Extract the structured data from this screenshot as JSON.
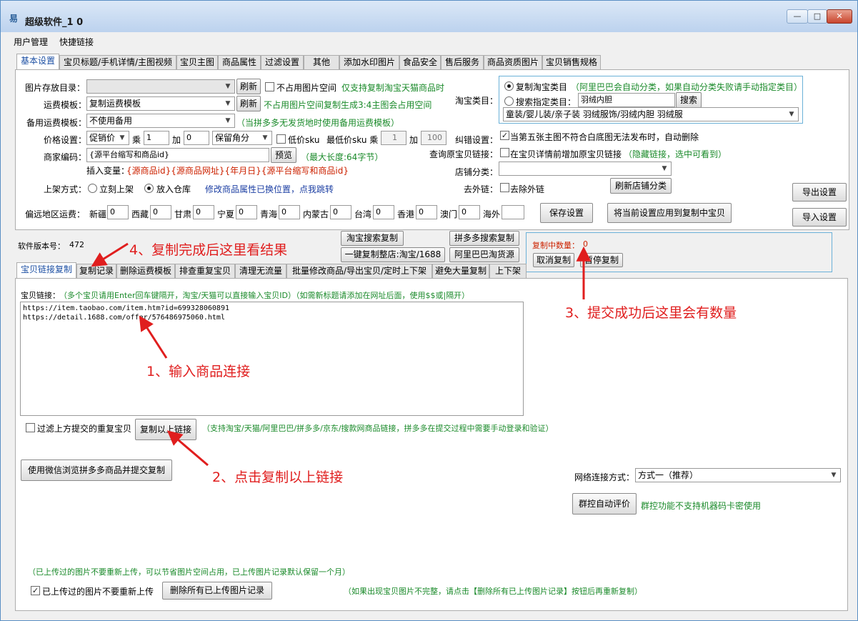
{
  "window": {
    "title": "超级软件_1 0",
    "btn_min": "—",
    "btn_max": "□",
    "btn_close": "✕"
  },
  "menu": [
    "用户管理",
    "快捷链接"
  ],
  "tabs_top": [
    "基本设置",
    "宝贝标题/手机详情/主图视频",
    "宝贝主图",
    "商品属性",
    "过滤设置",
    "其他",
    "添加水印图片",
    "食品安全",
    "售后服务",
    "商品资质图片",
    "宝贝销售规格"
  ],
  "basic": {
    "img_dir_label": "图片存放目录：",
    "img_dir_value": "",
    "refresh": "刷新",
    "no_img_space": "不占用图片空间",
    "only_taobao": "仅支持复制淘宝天猫商品时",
    "no_img_space_note": "不占用图片空间复制生成3:4主图会占用空间",
    "freight_label": "运费模板：",
    "freight_value": "复制运费模板",
    "backup_freight_label": "备用运费模板：",
    "backup_freight_value": "不使用备用",
    "backup_note": "（当拼多多无发货地时使用备用运费模板）",
    "price_label": "价格设置：",
    "price_mode": "促销价",
    "mul": "乘",
    "mul_value": "1",
    "add": "加",
    "add_value": "0",
    "round_mode": "保留角分",
    "low_sku": "低价sku",
    "min_sku": "最低价sku 乘",
    "min_sku_mul": "1",
    "min_sku_add_label": "加",
    "min_sku_add": "100",
    "merchant_code_label": "商家编码：",
    "merchant_code_value": "{源平台缩写和商品id}",
    "preview": "预览",
    "max_len": "（最大长度:64字节）",
    "insert_var": "插入变量：",
    "vars": "{源商品id}{源商品网址}{年月日}{源平台缩写和商品id}",
    "listing_label": "上架方式：",
    "listing_now": "立刻上架",
    "listing_store": "放入仓库",
    "attr_moved": "修改商品属性已换位置，点我跳转",
    "remote_label": "偏远地区运费：",
    "regions": [
      {
        "name": "新疆",
        "value": "0"
      },
      {
        "name": "西藏",
        "value": "0"
      },
      {
        "name": "甘肃",
        "value": "0"
      },
      {
        "name": "宁夏",
        "value": "0"
      },
      {
        "name": "青海",
        "value": "0"
      },
      {
        "name": "内蒙古",
        "value": "0"
      },
      {
        "name": "台湾",
        "value": "0"
      },
      {
        "name": "香港",
        "value": "0"
      },
      {
        "name": "澳门",
        "value": "0"
      },
      {
        "name": "海外",
        "value": ""
      }
    ],
    "save": "保存设置",
    "apply_copy": "将当前设置应用到复制中宝贝",
    "export": "导出设置",
    "import": "导入设置"
  },
  "category": {
    "label": "淘宝类目：",
    "copy_cat": "复制淘宝类目",
    "copy_note": "（阿里巴巴会自动分类，如果自动分类失败请手动指定类目）",
    "search_cat": "搜索指定类目：",
    "search_value": "羽绒内胆",
    "search_btn": "搜索",
    "cat_path": "童装/婴儿装/亲子装 羽绒服饰/羽绒内胆 羽绒服"
  },
  "right": {
    "error_label": "纠错设置：",
    "error_opt": "当第五张主图不符合白底图无法发布时，自动删除",
    "query_label": "查询原宝贝链接：",
    "query_opt": "在宝贝详情前增加原宝贝链接",
    "query_note": "（隐藏链接，选中可看到）",
    "shop_cat_label": "店铺分类：",
    "shop_cat_value": "",
    "outlink_label": "去外链：",
    "outlink_opt": "去除外链",
    "refresh_shop": "刷新店铺分类"
  },
  "version": {
    "label": "软件版本号：",
    "value": "472"
  },
  "search_buttons": [
    "淘宝搜索复制",
    "拼多多搜索复制",
    "一键复制整店:淘宝/1688",
    "阿里巴巴淘货源"
  ],
  "copying": {
    "label": "复制中数量：",
    "value": "0",
    "cancel": "取消复制",
    "pause": "暂停复制"
  },
  "tabs_bottom": [
    "宝贝链接复制",
    "复制记录",
    "删除运费模板",
    "排查重复宝贝",
    "清理无流量",
    "批量修改商品/导出宝贝/定时上下架",
    "避免大量复制",
    "上下架"
  ],
  "links": {
    "label": "宝贝链接：",
    "hint": "（多个宝贝请用Enter回车键隔开，淘宝/天猫可以直接输入宝贝ID）（如需新标题请添加在网址后面，使用$$或|隔开）",
    "lines": [
      "https://item.taobao.com/item.htm?id=699328060891",
      "https://detail.1688.com/offer/576486975060.html"
    ],
    "filter_dup": "过滤上方提交的重复宝贝",
    "copy_btn": "复制以上链接",
    "support_note": "（支持淘宝/天猫/阿里巴巴/拼多多/京东/搜款网商品链接，拼多多在提交过程中需要手动登录和验证）",
    "wechat_btn": "使用微信浏览拼多多商品并提交复制",
    "net_label": "网络连接方式：",
    "net_value": "方式一（推荐）",
    "group_btn": "群控自动评价",
    "group_note": "群控功能不支持机器码卡密使用",
    "uploaded_note": "（已上传过的图片不要重新上传，可以节省图片空间占用，已上传图片记录默认保留一个月）",
    "uploaded_opt": "已上传过的图片不要重新上传",
    "delete_records": "删除所有已上传图片记录",
    "incomplete_note": "（如果出现宝贝图片不完整，请点击【删除所有已上传图片记录】按钮后再重新复制）"
  },
  "annotations": {
    "a1": "1、输入商品连接",
    "a2": "2、点击复制以上链接",
    "a3": "3、提交成功后这里会有数量",
    "a4": "4、复制完成后这里看结果"
  },
  "colors": {
    "annotation": "#e01e1e",
    "green_text": "#1a8a2a",
    "blue_text": "#1c3fa3",
    "frame": "#5a8fc4"
  }
}
